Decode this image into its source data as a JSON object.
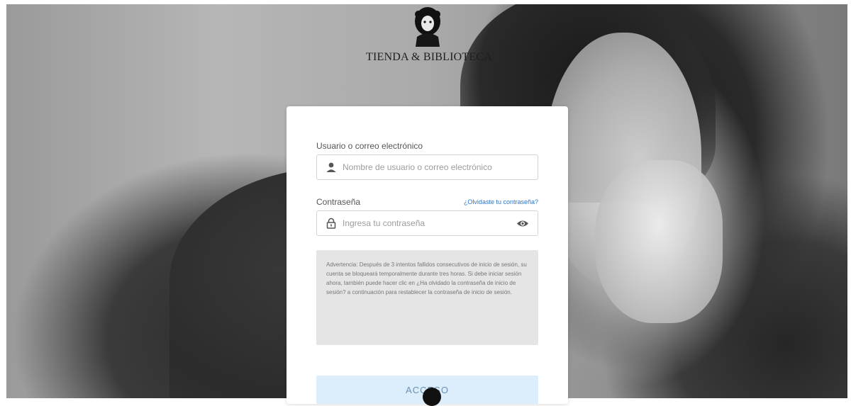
{
  "brand": {
    "name": "TIENDA & BIBLIOTECA"
  },
  "login": {
    "user_label": "Usuario o correo electrónico",
    "user_placeholder": "Nombre de usuario o correo electrónico",
    "password_label": "Contraseña",
    "forgot_link": "¿Olvidaste tu contraseña?",
    "password_placeholder": "Ingresa tu contraseña",
    "warning_text": "Advertencia: Después de 3 intentos fallidos consecutivos de inicio de sesión, su cuenta se bloqueará temporalmente durante tres horas. Si debe iniciar sesión ahora, también puede hacer clic en ¿Ha olvidado la contraseña de inicio de sesión? a continuación para restablecer la contraseña de inicio de sesión.",
    "submit_label": "ACCESO"
  },
  "colors": {
    "accent_link": "#2a77c9",
    "button_bg": "#dceefb",
    "button_text": "#6a8fb5"
  },
  "icons": {
    "user": "user-icon",
    "lock": "lock-icon",
    "eye": "eye-icon",
    "logo": "bust-logo-icon"
  }
}
